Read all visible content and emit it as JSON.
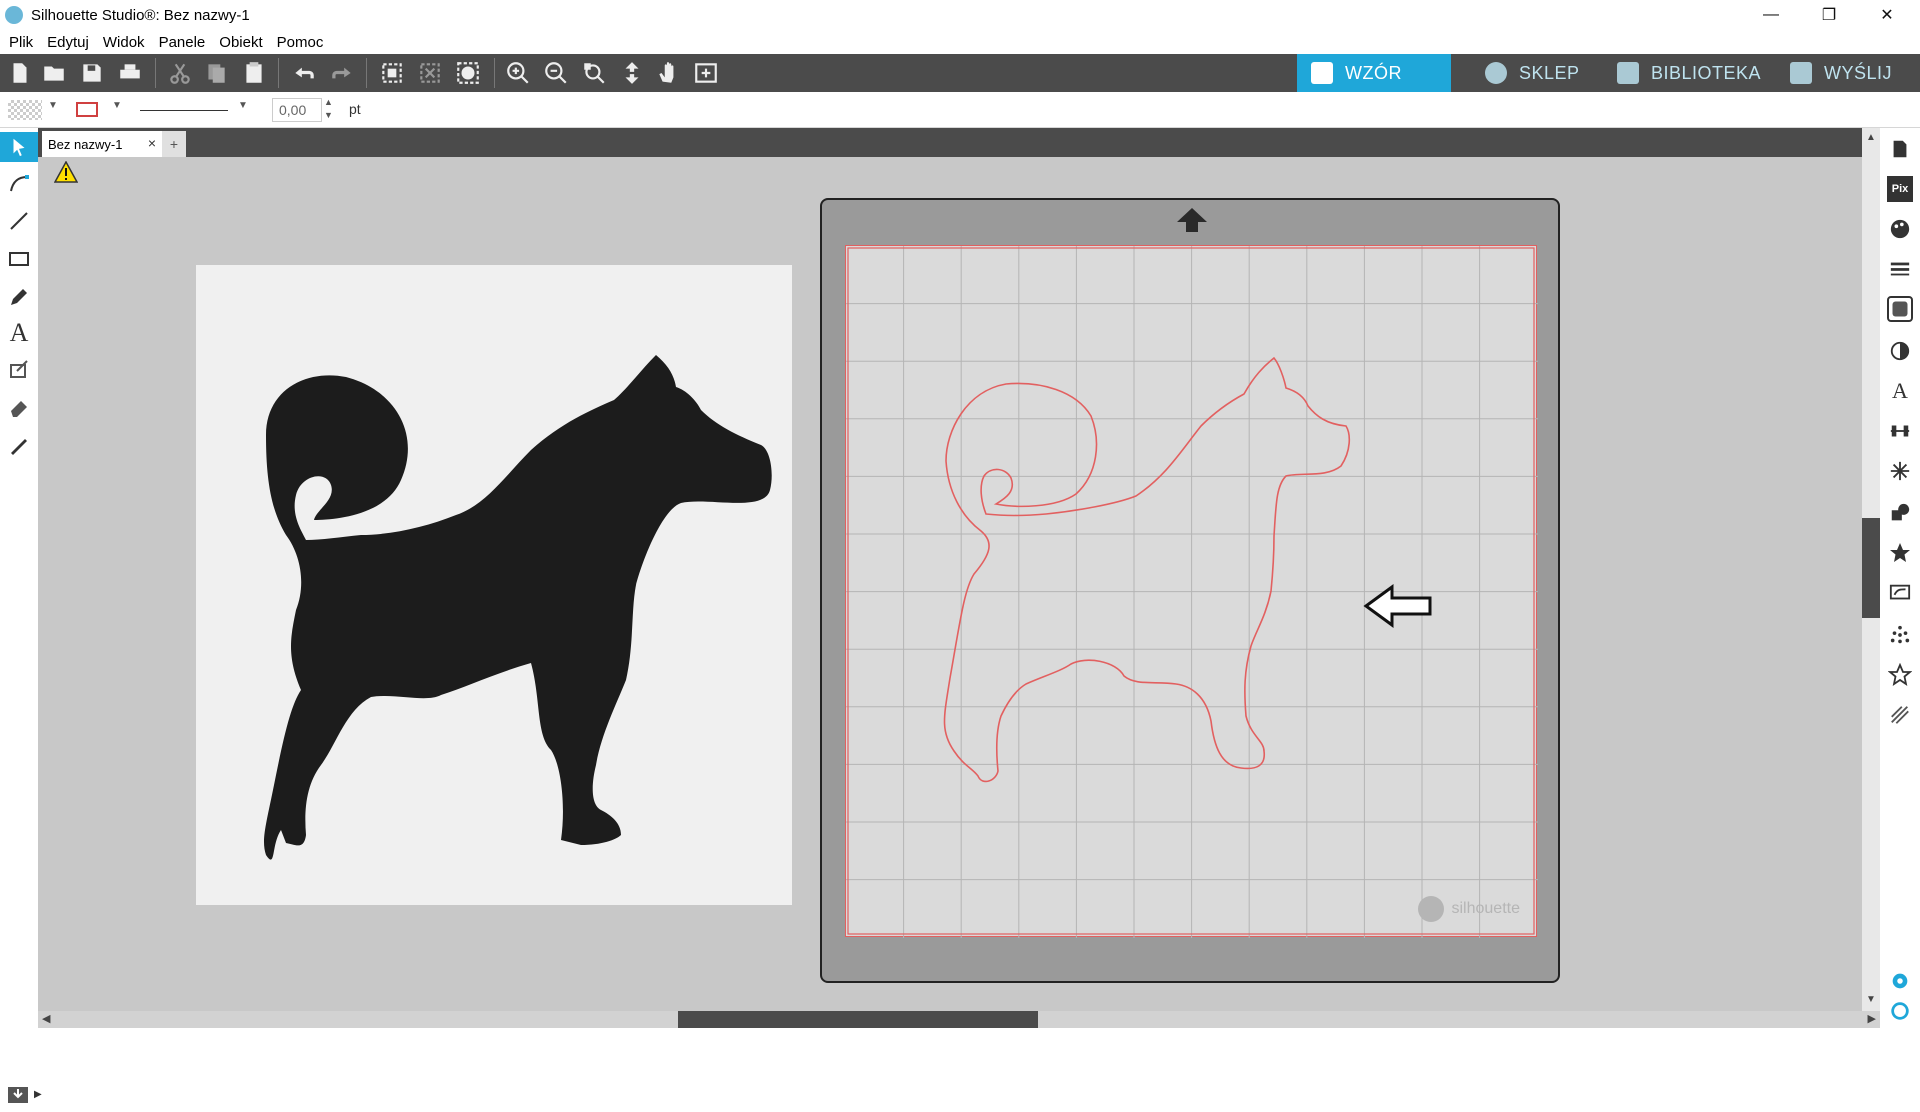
{
  "window": {
    "title": "Silhouette Studio®: Bez nazwy-1",
    "minimize": "—",
    "maximize": "❐",
    "close": "✕"
  },
  "menu": [
    "Plik",
    "Edytuj",
    "Widok",
    "Panele",
    "Obiekt",
    "Pomoc"
  ],
  "nav_tabs": [
    {
      "label": "WZÓR",
      "icon": "grid-icon",
      "active": true
    },
    {
      "label": "SKLEP",
      "icon": "silhouette-logo-icon",
      "active": false
    },
    {
      "label": "BIBLIOTEKA",
      "icon": "download-icon",
      "active": false
    },
    {
      "label": "WYŚLIJ",
      "icon": "cutter-icon",
      "active": false
    }
  ],
  "properties": {
    "line_width_value": "0,00",
    "line_width_unit": "pt"
  },
  "document": {
    "tab_label": "Bez nazwy-1",
    "close": "×",
    "new_tab": "+"
  },
  "mat": {
    "watermark": "silhouette"
  },
  "colors": {
    "accent": "#1fa7d9",
    "toolbar": "#4b4b4b",
    "cut_line": "#e26060",
    "canvas": "#c8c8c8",
    "silhouette_fill": "#1c1c1c"
  }
}
